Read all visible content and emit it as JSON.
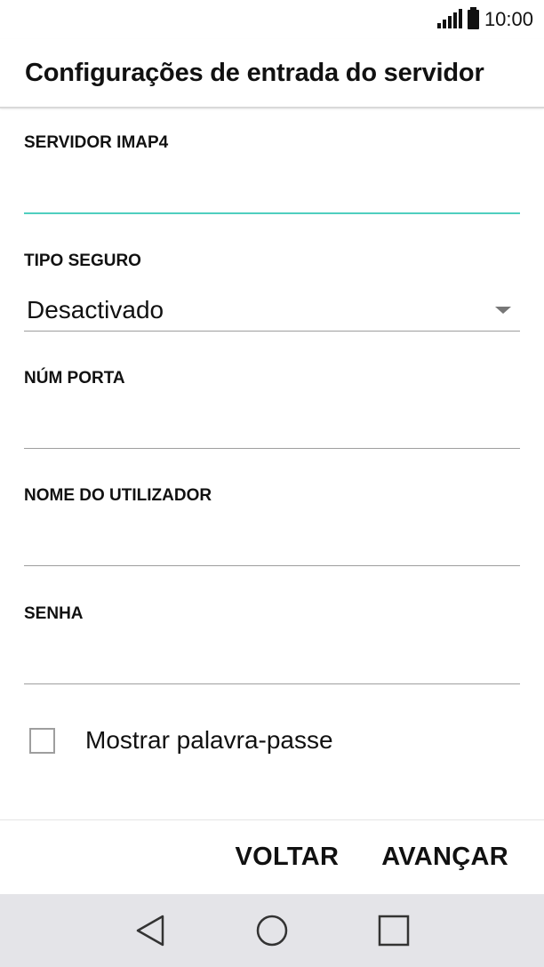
{
  "status_bar": {
    "time": "10:00",
    "signal_icon": "signal-icon",
    "battery_icon": "battery-icon"
  },
  "header": {
    "title": "Configurações de entrada do servidor"
  },
  "form": {
    "imap_server": {
      "label": "SERVIDOR IMAP4",
      "value": ""
    },
    "security_type": {
      "label": "TIPO SEGURO",
      "value": "Desactivado"
    },
    "port": {
      "label": "NÚM PORTA",
      "value": ""
    },
    "username": {
      "label": "NOME DO UTILIZADOR",
      "value": ""
    },
    "password": {
      "label": "SENHA",
      "value": ""
    },
    "show_password": {
      "label": "Mostrar palavra-passe",
      "checked": false
    }
  },
  "actions": {
    "back_label": "VOLTAR",
    "next_label": "AVANÇAR"
  },
  "nav": {
    "back_icon": "back-triangle-icon",
    "home_icon": "home-circle-icon",
    "recents_icon": "recents-square-icon"
  },
  "colors": {
    "focus_accent": "#4fcfbf",
    "nav_background": "#e4e4e8"
  }
}
